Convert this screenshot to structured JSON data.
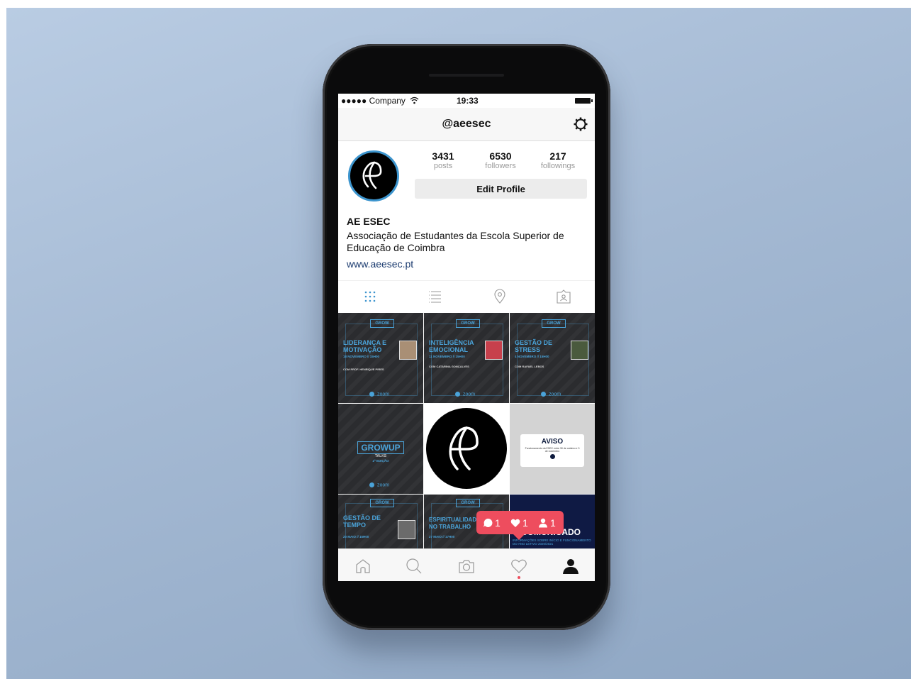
{
  "status_bar": {
    "carrier": "●●●●● Company",
    "time": "19:33"
  },
  "header": {
    "username": "@aeesec"
  },
  "profile": {
    "stats": [
      {
        "value": "3431",
        "label": "posts"
      },
      {
        "value": "6530",
        "label": "followers"
      },
      {
        "value": "217",
        "label": "followings"
      }
    ],
    "edit_button": "Edit Profile",
    "name": "AE ESEC",
    "bio": "Associação de Estudantes da Escola Superior de Educação de Coimbra",
    "website": "www.aeesec.pt"
  },
  "posts": [
    {
      "badge": "GROW",
      "title": "LIDERANÇA E MOTIVAÇÃO",
      "date": "18 NOVEMBRO // 15H00",
      "speaker": "COM PROF. HENRIQUE PIRES",
      "zoom": "zoom"
    },
    {
      "badge": "GROW",
      "title": "INTELIGÊNCIA EMOCIONAL",
      "date": "11 NOVEMBRO // 15H00",
      "speaker": "COM CATARINA GONÇALVES",
      "zoom": "zoom"
    },
    {
      "badge": "GROW",
      "title": "GESTÃO DE STRESS",
      "date": "4 NOVEMBRO // 15H00",
      "speaker": "COM RAFAEL LEBOS",
      "zoom": "zoom"
    },
    {
      "badge": "GROWUP",
      "subtitle": "TALKS",
      "edition": "2ª EDIÇÃO",
      "zoom": "zoom"
    },
    {
      "aviso_title": "AVISO",
      "aviso_text": "Funcionamento da ESEC entre 30 de outubro e 3 de novembro"
    },
    {
      "badge": "GROW",
      "title": "GESTÃO DE TEMPO",
      "date": "20 MAIO // 15H00"
    },
    {
      "badge": "GROW",
      "title": "ESPIRITUALIDADE NO TRABALHO",
      "date": "27 MAIO // 17H00"
    },
    {
      "title": "COMUNICADO",
      "subtitle": "INFORMAÇÕES SOBRE INÍCIO E FUNCIONAMENTO DO ANO LETIVO 2020/2021"
    }
  ],
  "notifications": {
    "comments": "1",
    "likes": "1",
    "follows": "1"
  },
  "icons": [
    "wifi-icon",
    "battery-icon",
    "gear-icon",
    "grid-icon",
    "list-icon",
    "location-icon",
    "tagged-icon",
    "home-icon",
    "search-icon",
    "camera-icon",
    "heart-icon",
    "profile-icon"
  ],
  "colors": {
    "accent": "#3d95ce",
    "notification": "#ee4d5e",
    "link": "#1b3b6f"
  }
}
